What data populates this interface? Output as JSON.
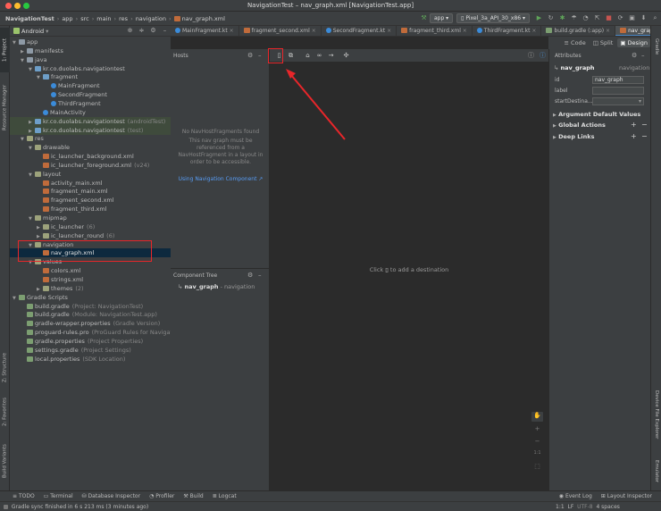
{
  "window": {
    "title": "NavigationTest – nav_graph.xml [NavigationTest.app]"
  },
  "breadcrumb": [
    "NavigationTest",
    "app",
    "src",
    "main",
    "res",
    "navigation",
    "nav_graph.xml"
  ],
  "run_config": {
    "module": "app",
    "device": "Pixel_3a_API_30_x86"
  },
  "project": {
    "view_label": "Android",
    "tree": [
      {
        "label": "app",
        "indent": 0,
        "icon": "folder",
        "arrow": "▼",
        "tone": "normal"
      },
      {
        "label": "manifests",
        "indent": 1,
        "icon": "folder",
        "arrow": "▶",
        "tone": "normal"
      },
      {
        "label": "java",
        "indent": 1,
        "icon": "folder",
        "arrow": "▼",
        "tone": "normal"
      },
      {
        "label": "kr.co.duolabs.navigationtest",
        "indent": 2,
        "icon": "folder-blue",
        "arrow": "▼",
        "tone": "normal"
      },
      {
        "label": "fragment",
        "indent": 3,
        "icon": "folder-blue",
        "arrow": "▼",
        "tone": "normal"
      },
      {
        "label": "MainFragment",
        "indent": 4,
        "icon": "kotlin",
        "arrow": "",
        "tone": "normal"
      },
      {
        "label": "SecondFragment",
        "indent": 4,
        "icon": "kotlin",
        "arrow": "",
        "tone": "normal"
      },
      {
        "label": "ThirdFragment",
        "indent": 4,
        "icon": "kotlin",
        "arrow": "",
        "tone": "normal"
      },
      {
        "label": "MainActivity",
        "indent": 3,
        "icon": "kotlin",
        "arrow": "",
        "tone": "normal"
      },
      {
        "label": "kr.co.duolabs.navigationtest",
        "suffix": "(androidTest)",
        "indent": 2,
        "icon": "folder-blue",
        "arrow": "▶",
        "tone": "test"
      },
      {
        "label": "kr.co.duolabs.navigationtest",
        "suffix": "(test)",
        "indent": 2,
        "icon": "folder-blue",
        "arrow": "▶",
        "tone": "test"
      },
      {
        "label": "res",
        "indent": 1,
        "icon": "folder-res",
        "arrow": "▼",
        "tone": "normal"
      },
      {
        "label": "drawable",
        "indent": 2,
        "icon": "folder-res",
        "arrow": "▼",
        "tone": "normal"
      },
      {
        "label": "ic_launcher_background.xml",
        "indent": 3,
        "icon": "xml",
        "arrow": "",
        "tone": "normal"
      },
      {
        "label": "ic_launcher_foreground.xml",
        "suffix": "(v24)",
        "indent": 3,
        "icon": "xml",
        "arrow": "",
        "tone": "normal"
      },
      {
        "label": "layout",
        "indent": 2,
        "icon": "folder-res",
        "arrow": "▼",
        "tone": "normal"
      },
      {
        "label": "activity_main.xml",
        "indent": 3,
        "icon": "xml",
        "arrow": "",
        "tone": "normal"
      },
      {
        "label": "fragment_main.xml",
        "indent": 3,
        "icon": "xml",
        "arrow": "",
        "tone": "normal"
      },
      {
        "label": "fragment_second.xml",
        "indent": 3,
        "icon": "xml",
        "arrow": "",
        "tone": "normal"
      },
      {
        "label": "fragment_third.xml",
        "indent": 3,
        "icon": "xml",
        "arrow": "",
        "tone": "normal"
      },
      {
        "label": "mipmap",
        "indent": 2,
        "icon": "folder-res",
        "arrow": "▼",
        "tone": "normal"
      },
      {
        "label": "ic_launcher",
        "suffix": "(6)",
        "indent": 3,
        "icon": "folder-res",
        "arrow": "▶",
        "tone": "normal"
      },
      {
        "label": "ic_launcher_round",
        "suffix": "(6)",
        "indent": 3,
        "icon": "folder-res",
        "arrow": "▶",
        "tone": "normal"
      },
      {
        "label": "navigation",
        "indent": 2,
        "icon": "folder-res",
        "arrow": "▼",
        "tone": "normal"
      },
      {
        "label": "nav_graph.xml",
        "indent": 3,
        "icon": "xml",
        "arrow": "",
        "tone": "selected"
      },
      {
        "label": "values",
        "indent": 2,
        "icon": "folder-res",
        "arrow": "▼",
        "tone": "normal"
      },
      {
        "label": "colors.xml",
        "indent": 3,
        "icon": "xml",
        "arrow": "",
        "tone": "normal"
      },
      {
        "label": "strings.xml",
        "indent": 3,
        "icon": "xml",
        "arrow": "",
        "tone": "normal"
      },
      {
        "label": "themes",
        "suffix": "(2)",
        "indent": 3,
        "icon": "folder-res",
        "arrow": "▶",
        "tone": "normal"
      },
      {
        "label": "Gradle Scripts",
        "indent": 0,
        "icon": "gradle",
        "arrow": "▼",
        "tone": "normal"
      },
      {
        "label": "build.gradle",
        "suffix": "(Project: NavigationTest)",
        "indent": 1,
        "icon": "gradle",
        "arrow": "",
        "tone": "normal"
      },
      {
        "label": "build.gradle",
        "suffix": "(Module: NavigationTest.app)",
        "indent": 1,
        "icon": "gradle",
        "arrow": "",
        "tone": "normal"
      },
      {
        "label": "gradle-wrapper.properties",
        "suffix": "(Gradle Version)",
        "indent": 1,
        "icon": "gradle",
        "arrow": "",
        "tone": "normal"
      },
      {
        "label": "proguard-rules.pro",
        "suffix": "(ProGuard Rules for Navigat",
        "indent": 1,
        "icon": "gradle",
        "arrow": "",
        "tone": "normal"
      },
      {
        "label": "gradle.properties",
        "suffix": "(Project Properties)",
        "indent": 1,
        "icon": "gradle",
        "arrow": "",
        "tone": "normal"
      },
      {
        "label": "settings.gradle",
        "suffix": "(Project Settings)",
        "indent": 1,
        "icon": "gradle",
        "arrow": "",
        "tone": "normal"
      },
      {
        "label": "local.properties",
        "suffix": "(SDK Location)",
        "indent": 1,
        "icon": "gradle",
        "arrow": "",
        "tone": "normal"
      }
    ]
  },
  "editor_tabs": [
    {
      "label": "MainFragment.kt",
      "active": false
    },
    {
      "label": "fragment_second.xml",
      "active": false
    },
    {
      "label": "SecondFragment.kt",
      "active": false
    },
    {
      "label": "fragment_third.xml",
      "active": false
    },
    {
      "label": "ThirdFragment.kt",
      "active": false
    },
    {
      "label": "build.gradle (:app)",
      "active": false
    },
    {
      "label": "nav_graph.xml",
      "active": true
    }
  ],
  "view_modes": {
    "code": "Code",
    "split": "Split",
    "design": "Design"
  },
  "hosts": {
    "title": "Hosts",
    "message": "No NavHostFragments found",
    "detail": "This nav graph must be referenced from a NavHostFragment in a layout in order to be accessible.",
    "link": "Using Navigation Component ↗"
  },
  "component_tree": {
    "title": "Component Tree",
    "root_label": "nav_graph",
    "root_suffix": "- navigation"
  },
  "canvas": {
    "hint_prefix": "Click",
    "hint_suffix": "to add a destination"
  },
  "attributes": {
    "title": "Attributes",
    "element_name": "nav_graph",
    "element_type": "navigation",
    "fields": [
      {
        "label": "id",
        "value": "nav_graph"
      },
      {
        "label": "label",
        "value": ""
      },
      {
        "label": "startDestina...",
        "value": ""
      }
    ],
    "sections": [
      "Argument Default Values",
      "Global Actions",
      "Deep Links"
    ]
  },
  "left_strip_tabs": [
    "1: Project",
    "Resource Manager",
    "Z: Structure",
    "2: Favorites",
    "Build Variants"
  ],
  "right_strip_tabs": [
    "Gradle",
    "Device File Explorer",
    "Emulator"
  ],
  "bottom_tabs": [
    "TODO",
    "Terminal",
    "Database Inspector",
    "Profiler",
    "Build",
    "Logcat"
  ],
  "bottom_tabs_right": [
    "Event Log",
    "Layout Inspector"
  ],
  "status": {
    "message": "Gradle sync finished in 6 s 213 ms (3 minutes ago)",
    "position": "1:1",
    "line_sep": "LF",
    "encoding": "UTF-8",
    "indent": "4 spaces"
  },
  "colors": {
    "highlight": "#e8262a",
    "accent_blue": "#4a88c7",
    "link": "#589df6",
    "selection": "#0d293e"
  }
}
